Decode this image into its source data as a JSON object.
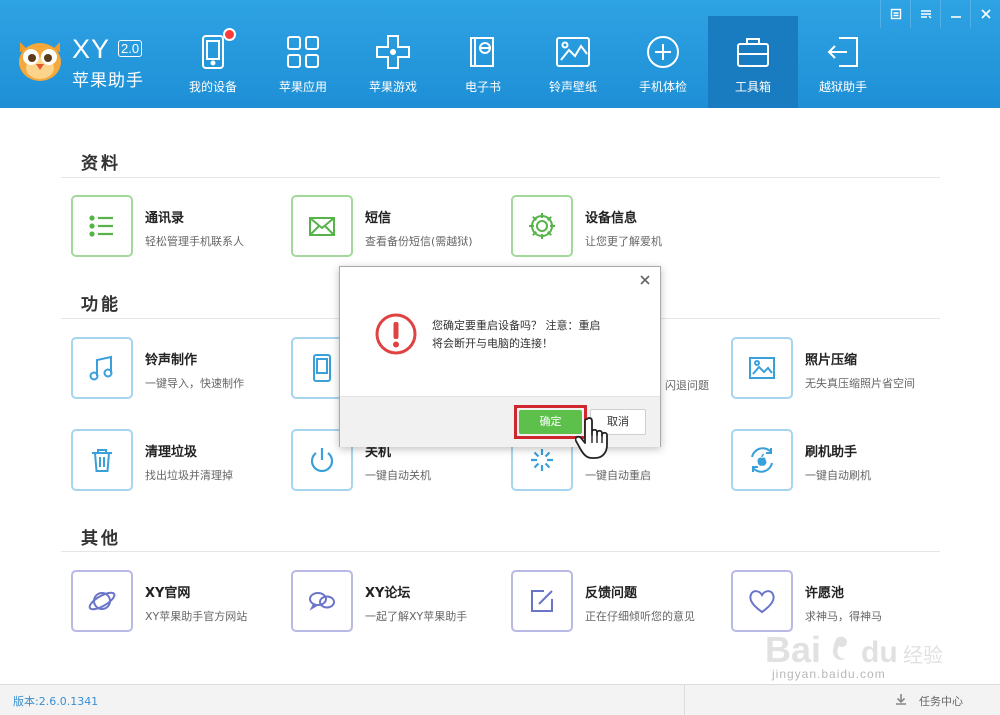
{
  "app": {
    "brand": "XY",
    "version_badge": "2.0",
    "name": "苹果助手"
  },
  "colors": {
    "header": "#1e8fd6",
    "active_tab": "#1a7cc0",
    "green": "#55b348",
    "blue": "#3aa0da",
    "purple": "#6a74c9",
    "confirm": "#5cc04b",
    "highlight": "#d0272e"
  },
  "window_controls": [
    "menu-icon",
    "skin-icon",
    "minimize-icon",
    "close-icon"
  ],
  "nav": [
    {
      "label": "我的设备",
      "icon": "device-icon",
      "badge": true
    },
    {
      "label": "苹果应用",
      "icon": "apps-grid-icon"
    },
    {
      "label": "苹果游戏",
      "icon": "gamepad-icon"
    },
    {
      "label": "电子书",
      "icon": "ebook-icon"
    },
    {
      "label": "铃声壁纸",
      "icon": "wallpaper-icon"
    },
    {
      "label": "手机体检",
      "icon": "health-check-icon"
    },
    {
      "label": "工具箱",
      "icon": "toolbox-icon",
      "active": true
    },
    {
      "label": "越狱助手",
      "icon": "jailbreak-icon"
    }
  ],
  "sections": {
    "data": {
      "title": "资料",
      "items": [
        {
          "title": "通讯录",
          "sub": "轻松管理手机联系人",
          "icon": "contacts-list-icon"
        },
        {
          "title": "短信",
          "sub": "查看备份短信(需越狱)",
          "icon": "envelope-icon"
        },
        {
          "title": "设备信息",
          "sub": "让您更了解爱机",
          "icon": "gear-icon"
        }
      ]
    },
    "functions": {
      "title": "功能",
      "items": [
        {
          "title": "铃声制作",
          "sub": "一键导入，快速制作",
          "icon": "music-note-icon"
        },
        {
          "title": "",
          "sub": "",
          "icon": "phone-icon"
        },
        {
          "title": "",
          "sub": "闪退问题",
          "icon": ""
        },
        {
          "title": "照片压缩",
          "sub": "无失真压缩照片省空间",
          "icon": "photo-icon"
        },
        {
          "title": "清理垃圾",
          "sub": "找出垃圾并清理掉",
          "icon": "trash-icon"
        },
        {
          "title": "关机",
          "sub": "一键自动关机",
          "icon": "power-icon"
        },
        {
          "title": "",
          "sub": "一键自动重启",
          "icon": "restart-spinner-icon"
        },
        {
          "title": "刷机助手",
          "sub": "一键自动刷机",
          "icon": "flash-apple-icon"
        }
      ]
    },
    "other": {
      "title": "其他",
      "items": [
        {
          "title": "XY官网",
          "sub": "XY苹果助手官方网站",
          "icon": "planet-icon"
        },
        {
          "title": "XY论坛",
          "sub": "一起了解XY苹果助手",
          "icon": "chat-bubbles-icon"
        },
        {
          "title": "反馈问题",
          "sub": "正在仔细倾听您的意见",
          "icon": "edit-icon"
        },
        {
          "title": "许愿池",
          "sub": "求神马，得神马",
          "icon": "heart-icon"
        }
      ]
    }
  },
  "dialog": {
    "message_line1": "您确定要重启设备吗？ 注意：重启",
    "message_line2": "将会断开与电脑的连接！",
    "confirm_label": "确定",
    "cancel_label": "取消"
  },
  "status": {
    "version": "版本:2.6.0.1341",
    "task_center": "任务中心"
  },
  "watermark": {
    "brand": "Bai 经验",
    "url": "jingyan.baidu.com"
  }
}
